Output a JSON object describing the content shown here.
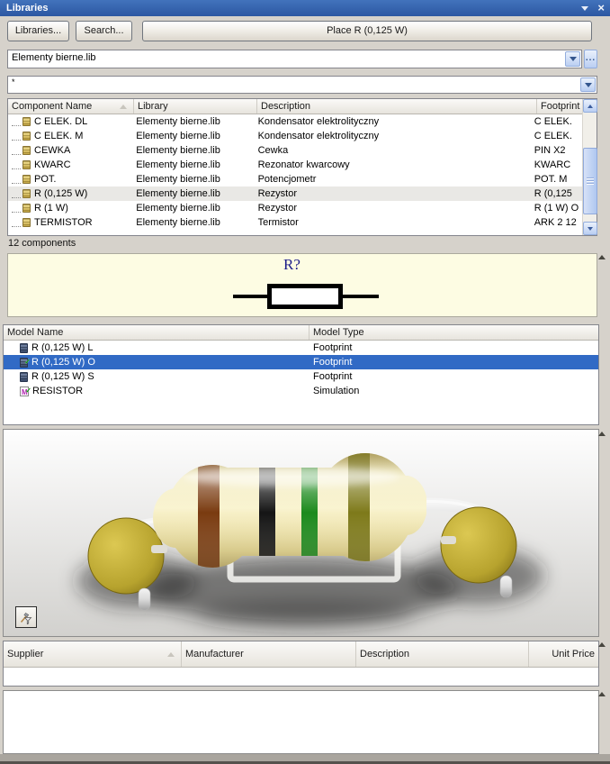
{
  "titlebar": {
    "title": "Libraries",
    "close_icon": "×"
  },
  "toolbar": {
    "libraries_label": "Libraries...",
    "search_label": "Search...",
    "place_label": "Place R (0,125 W)"
  },
  "library_combo": {
    "value": "Elementy bierne.lib",
    "browse_label": "..."
  },
  "filter_combo": {
    "value": "*"
  },
  "components": {
    "columns": [
      "Component Name",
      "Library",
      "Description",
      "Footprint"
    ],
    "rows": [
      {
        "name": "C ELEK. DL",
        "library": "Elementy bierne.lib",
        "description": "Kondensator elektrolityczny",
        "footprint": "C ELEK.",
        "highlighted": false
      },
      {
        "name": "C ELEK. M",
        "library": "Elementy bierne.lib",
        "description": "Kondensator elektrolityczny",
        "footprint": "C ELEK.",
        "highlighted": false
      },
      {
        "name": "CEWKA",
        "library": "Elementy bierne.lib",
        "description": "Cewka",
        "footprint": "PIN X2",
        "highlighted": false
      },
      {
        "name": "KWARC",
        "library": "Elementy bierne.lib",
        "description": "Rezonator kwarcowy",
        "footprint": "KWARC",
        "highlighted": false
      },
      {
        "name": "POT.",
        "library": "Elementy bierne.lib",
        "description": "Potencjometr",
        "footprint": "POT. M",
        "highlighted": false
      },
      {
        "name": "R (0,125 W)",
        "library": "Elementy bierne.lib",
        "description": "Rezystor",
        "footprint": "R (0,125",
        "highlighted": true
      },
      {
        "name": "R (1 W)",
        "library": "Elementy bierne.lib",
        "description": "Rezystor",
        "footprint": "R (1 W) O",
        "highlighted": false
      },
      {
        "name": "TERMISTOR",
        "library": "Elementy bierne.lib",
        "description": "Termistor",
        "footprint": "ARK 2 12",
        "highlighted": false
      }
    ],
    "status": "12 components"
  },
  "symbol_preview": {
    "designator": "R?"
  },
  "models": {
    "columns": [
      "Model Name",
      "Model Type"
    ],
    "rows": [
      {
        "name": "R (0,125 W) L",
        "type": "Footprint",
        "icon": "footprint",
        "checked": false,
        "selected": false
      },
      {
        "name": "R (0,125 W) O",
        "type": "Footprint",
        "icon": "footprint",
        "checked": true,
        "selected": true
      },
      {
        "name": "R (0,125 W) S",
        "type": "Footprint",
        "icon": "footprint",
        "checked": false,
        "selected": false
      },
      {
        "name": "RESISTOR",
        "type": "Simulation",
        "icon": "simulation",
        "checked": true,
        "selected": false
      }
    ]
  },
  "suppliers": {
    "columns": [
      "Supplier",
      "Manufacturer",
      "Description",
      "Unit Price"
    ]
  },
  "colors": {
    "titlebar_blue": "#3665AC",
    "selection_blue": "#316AC5",
    "row_highlight": "#E9E8E5",
    "preview_bg": "#FDFCE3",
    "resistor_body": "#F0E6A8",
    "resistor_bands": [
      "#7A3B10",
      "#151515",
      "#1C8A1C",
      "#7E7A1A"
    ],
    "resistor_leads": "#D6D6D6",
    "resistor_pads": "#C0AC30"
  }
}
